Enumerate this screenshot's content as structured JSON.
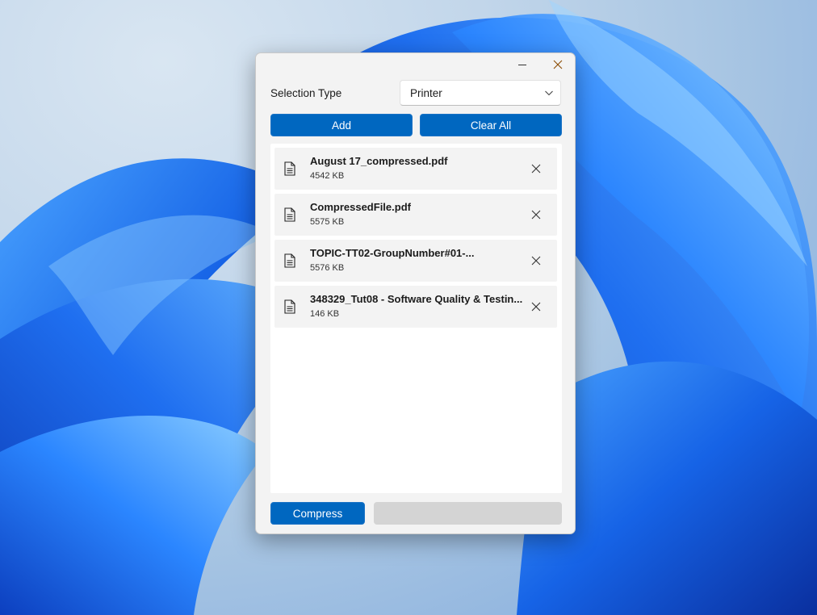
{
  "window": {
    "minimize_icon": "minimize-icon",
    "close_icon": "close-icon"
  },
  "selection": {
    "label": "Selection Type",
    "value": "Printer"
  },
  "buttons": {
    "add": "Add",
    "clear_all": "Clear All",
    "compress": "Compress"
  },
  "files": [
    {
      "name": "August 17_compressed.pdf",
      "size": "4542 KB"
    },
    {
      "name": "CompressedFile.pdf",
      "size": "5575 KB"
    },
    {
      "name": "TOPIC-TT02-GroupNumber#01-...",
      "size": "5576 KB"
    },
    {
      "name": "348329_Tut08 - Software Quality & Testin...",
      "size": "146 KB"
    }
  ],
  "progress": {
    "percent": 0
  },
  "colors": {
    "accent": "#0067c0",
    "progress_track": "#d4d4d4"
  }
}
